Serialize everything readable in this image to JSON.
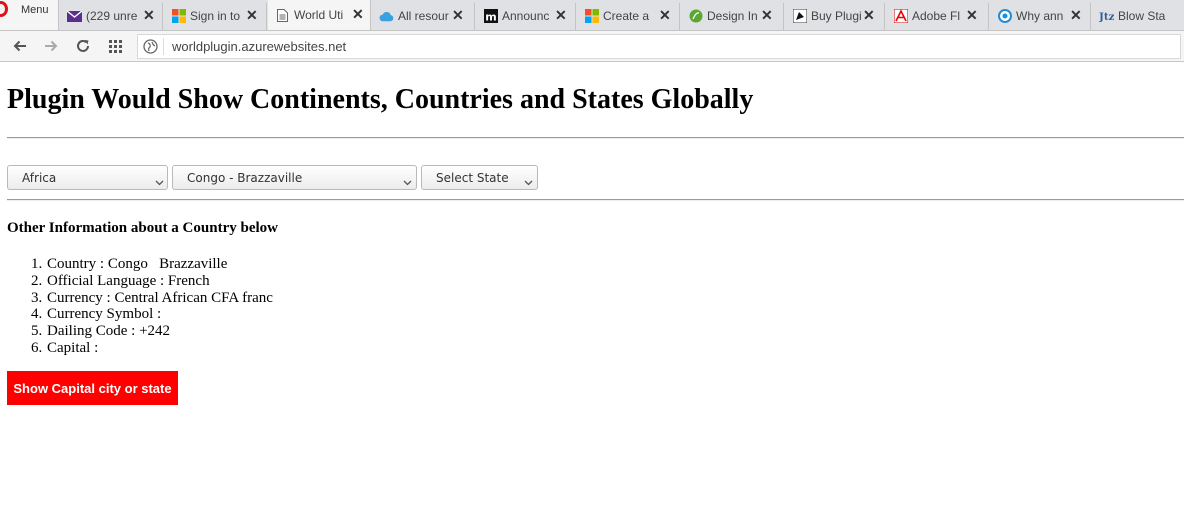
{
  "browser": {
    "menu_label": "Menu",
    "tabs": [
      {
        "title": "(229 unre",
        "icon": "mail-icon",
        "active": false
      },
      {
        "title": "Sign in to",
        "icon": "microsoft-icon",
        "active": false
      },
      {
        "title": "World Uti",
        "icon": "page-icon",
        "active": true
      },
      {
        "title": "All resour",
        "icon": "azure-cloud-icon",
        "active": false
      },
      {
        "title": "Announc",
        "icon": "m-logo-icon",
        "active": false
      },
      {
        "title": "Create a",
        "icon": "microsoft-icon",
        "active": false
      },
      {
        "title": "Design In",
        "icon": "leaf-icon",
        "active": false
      },
      {
        "title": "Buy Plugi",
        "icon": "envato-icon",
        "active": false
      },
      {
        "title": "Adobe Fl",
        "icon": "adobe-icon",
        "active": false
      },
      {
        "title": "Why ann",
        "icon": "circle-icon",
        "active": false
      },
      {
        "title": "Blow Sta",
        "icon": "jtz-icon",
        "active": false
      }
    ],
    "url": "worldplugin.azurewebsites.net"
  },
  "page": {
    "title": "Plugin Would Show Continents, Countries and States Globally",
    "selects": {
      "continent": "Africa",
      "country": "Congo - Brazzaville",
      "state": "Select State"
    },
    "info_heading": "Other Information about a Country below",
    "info_items": [
      {
        "num": "1.",
        "text": "Country : Congo   Brazzaville"
      },
      {
        "num": "2.",
        "text": "Official Language : French"
      },
      {
        "num": "3.",
        "text": "Currency : Central African CFA franc"
      },
      {
        "num": "4.",
        "text": "Currency Symbol :"
      },
      {
        "num": "5.",
        "text": "Dailing Code : +242"
      },
      {
        "num": "6.",
        "text": "Capital :"
      }
    ],
    "button_label": "Show Capital city or state"
  },
  "colors": {
    "button_bg": "#ff0000",
    "opera_red": "#e0101a"
  }
}
